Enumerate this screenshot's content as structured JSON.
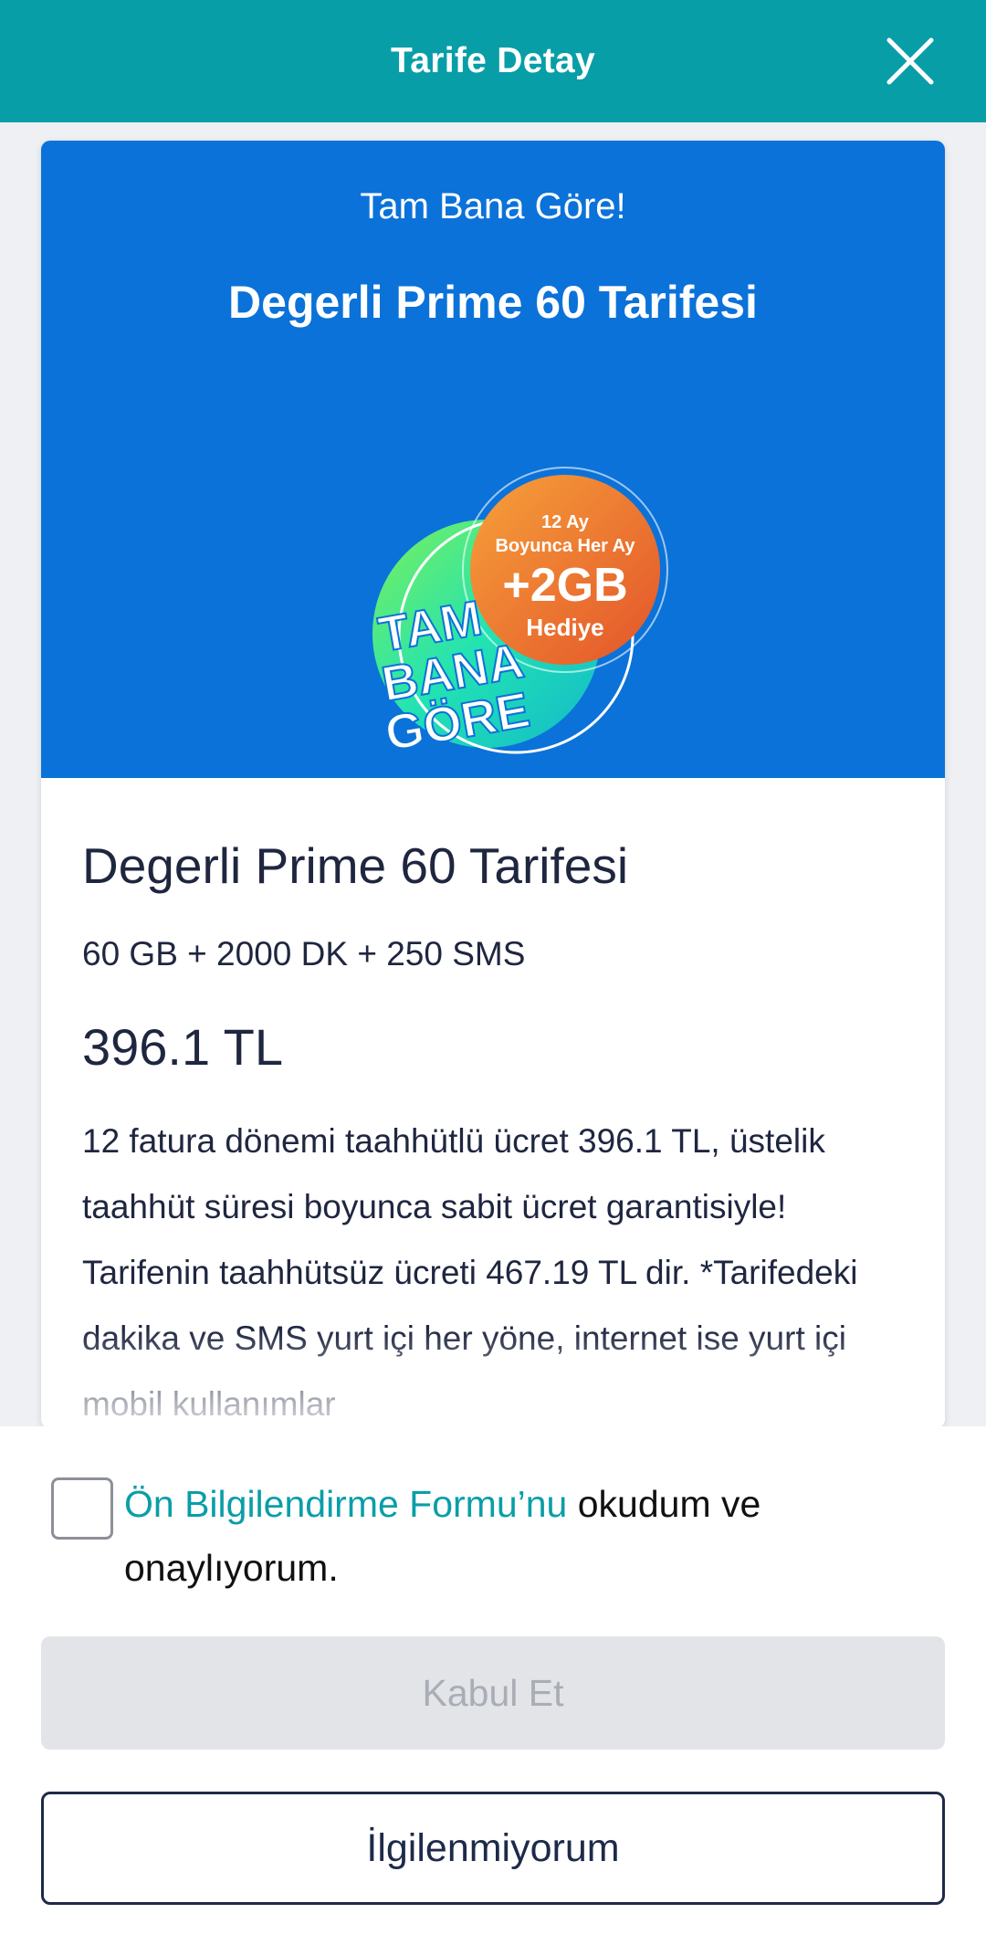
{
  "header": {
    "title": "Tarife Detay",
    "close_icon": "close-icon",
    "background_color": "#079ea8"
  },
  "banner": {
    "eyebrow": "Tam Bana Göre!",
    "title": "Degerli Prime 60 Tarifesi",
    "background_color": "#0b72d9",
    "promo": {
      "line1": "12 Ay",
      "line2": "Boyunca Her Ay",
      "amount": "+2GB",
      "line3": "Hediye",
      "brand_line1": "TAM",
      "brand_line2": "BANA",
      "brand_line3": "GÖRE"
    }
  },
  "tariff": {
    "name": "Degerli Prime 60 Tarifesi",
    "features": "60 GB + 2000 DK + 250 SMS",
    "price": "396.1 TL",
    "description": "12 fatura dönemi taahhütlü ücret 396.1 TL, üstelik taahhüt süresi boyunca sabit ücret garantisiyle! Tarifenin taahhütsüz ücreti 467.19 TL dir. *Tarifedeki dakika ve SMS yurt içi her yöne, internet ise yurt içi mobil kullanımlar"
  },
  "consent": {
    "checked": false,
    "link_text": "Ön Bilgilendirme Formu’nu",
    "rest_text": " okudum ve onaylıyorum."
  },
  "buttons": {
    "accept": "Kabul Et",
    "decline": "İlgilenmiyorum"
  }
}
